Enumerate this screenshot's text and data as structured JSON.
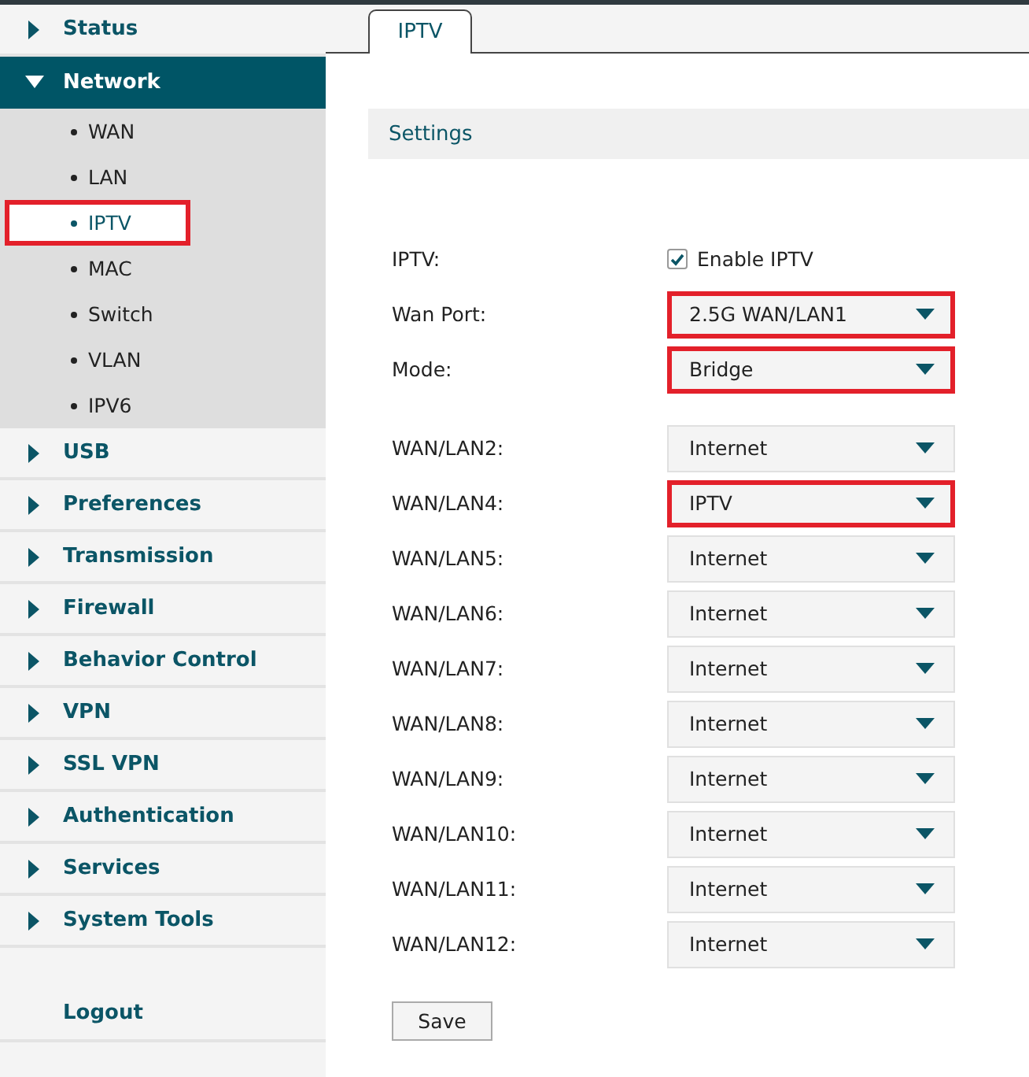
{
  "sidebar": {
    "items": [
      {
        "label": "Status",
        "expanded": false
      },
      {
        "label": "Network",
        "expanded": true,
        "children": [
          {
            "label": "WAN",
            "selected": false,
            "highlighted": false
          },
          {
            "label": "LAN",
            "selected": false,
            "highlighted": false
          },
          {
            "label": "IPTV",
            "selected": true,
            "highlighted": true
          },
          {
            "label": "MAC",
            "selected": false,
            "highlighted": false
          },
          {
            "label": "Switch",
            "selected": false,
            "highlighted": false
          },
          {
            "label": "VLAN",
            "selected": false,
            "highlighted": false
          },
          {
            "label": "IPV6",
            "selected": false,
            "highlighted": false
          }
        ]
      },
      {
        "label": "USB",
        "expanded": false
      },
      {
        "label": "Preferences",
        "expanded": false
      },
      {
        "label": "Transmission",
        "expanded": false
      },
      {
        "label": "Firewall",
        "expanded": false
      },
      {
        "label": "Behavior Control",
        "expanded": false
      },
      {
        "label": "VPN",
        "expanded": false
      },
      {
        "label": "SSL VPN",
        "expanded": false
      },
      {
        "label": "Authentication",
        "expanded": false
      },
      {
        "label": "Services",
        "expanded": false
      },
      {
        "label": "System Tools",
        "expanded": false
      }
    ],
    "logout": "Logout"
  },
  "tabs": [
    {
      "label": "IPTV",
      "selected": true
    }
  ],
  "section_title": "Settings",
  "iptv": {
    "label": "IPTV:",
    "checkbox_label": "Enable IPTV",
    "checked": true
  },
  "fields": [
    {
      "label": "Wan Port:",
      "value": "2.5G WAN/LAN1",
      "highlighted": true
    },
    {
      "label": "Mode:",
      "value": "Bridge",
      "highlighted": true
    }
  ],
  "ports": [
    {
      "label": "WAN/LAN2:",
      "value": "Internet",
      "highlighted": false
    },
    {
      "label": "WAN/LAN4:",
      "value": "IPTV",
      "highlighted": true
    },
    {
      "label": "WAN/LAN5:",
      "value": "Internet",
      "highlighted": false
    },
    {
      "label": "WAN/LAN6:",
      "value": "Internet",
      "highlighted": false
    },
    {
      "label": "WAN/LAN7:",
      "value": "Internet",
      "highlighted": false
    },
    {
      "label": "WAN/LAN8:",
      "value": "Internet",
      "highlighted": false
    },
    {
      "label": "WAN/LAN9:",
      "value": "Internet",
      "highlighted": false
    },
    {
      "label": "WAN/LAN10:",
      "value": "Internet",
      "highlighted": false
    },
    {
      "label": "WAN/LAN11:",
      "value": "Internet",
      "highlighted": false
    },
    {
      "label": "WAN/LAN12:",
      "value": "Internet",
      "highlighted": false
    }
  ],
  "save_button": "Save"
}
